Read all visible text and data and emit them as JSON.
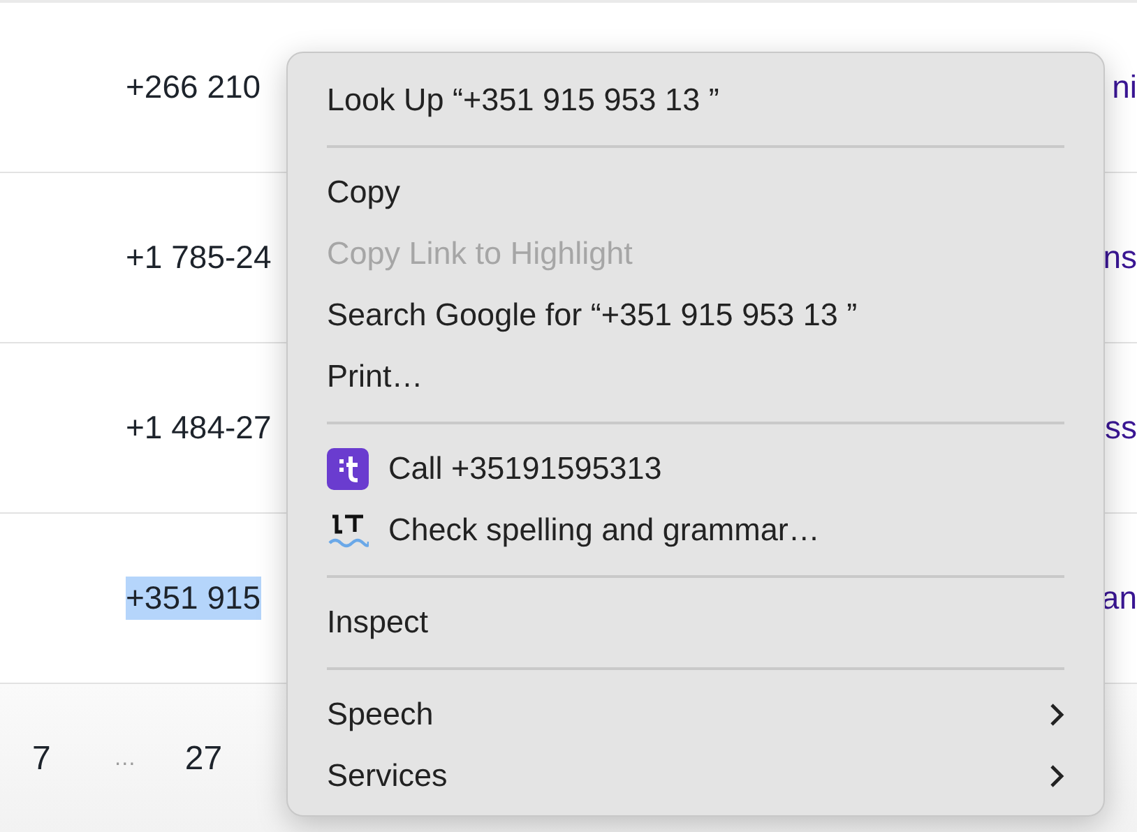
{
  "table": {
    "rows": [
      {
        "phone": "+266 210",
        "column_3": "ni",
        "highlighted": false
      },
      {
        "phone": "+1 785-24",
        "column_3": "ns",
        "highlighted": false
      },
      {
        "phone": "+1 484-27",
        "column_3": "ss",
        "highlighted": false
      },
      {
        "phone": "+351 915",
        "column_3": "an",
        "highlighted": true
      }
    ]
  },
  "pagination": {
    "pages": [
      {
        "label": "7",
        "kind": "page"
      },
      {
        "label": "…",
        "kind": "gap"
      },
      {
        "label": "27",
        "kind": "page"
      }
    ]
  },
  "context_menu": {
    "items": [
      {
        "kind": "item",
        "label": "Look Up “+351 915 953 13 ”",
        "disabled": false,
        "submenu": false
      },
      {
        "kind": "separator"
      },
      {
        "kind": "item",
        "label": "Copy",
        "disabled": false,
        "submenu": false
      },
      {
        "kind": "item",
        "label": "Copy Link to Highlight",
        "disabled": true,
        "submenu": false
      },
      {
        "kind": "item",
        "label": "Search Google for “+351 915 953 13 ”",
        "disabled": false,
        "submenu": false
      },
      {
        "kind": "item",
        "label": "Print…",
        "disabled": false,
        "submenu": false
      },
      {
        "kind": "separator"
      },
      {
        "kind": "call-item",
        "label": "Call +35191595313",
        "disabled": false,
        "submenu": false
      },
      {
        "kind": "spelling-item",
        "label": "Check spelling and grammar…",
        "disabled": false,
        "submenu": false
      },
      {
        "kind": "separator"
      },
      {
        "kind": "item",
        "label": "Inspect",
        "disabled": false,
        "submenu": false
      },
      {
        "kind": "separator"
      },
      {
        "kind": "item",
        "label": "Speech",
        "disabled": false,
        "submenu": true
      },
      {
        "kind": "item",
        "label": "Services",
        "disabled": false,
        "submenu": true
      }
    ]
  }
}
